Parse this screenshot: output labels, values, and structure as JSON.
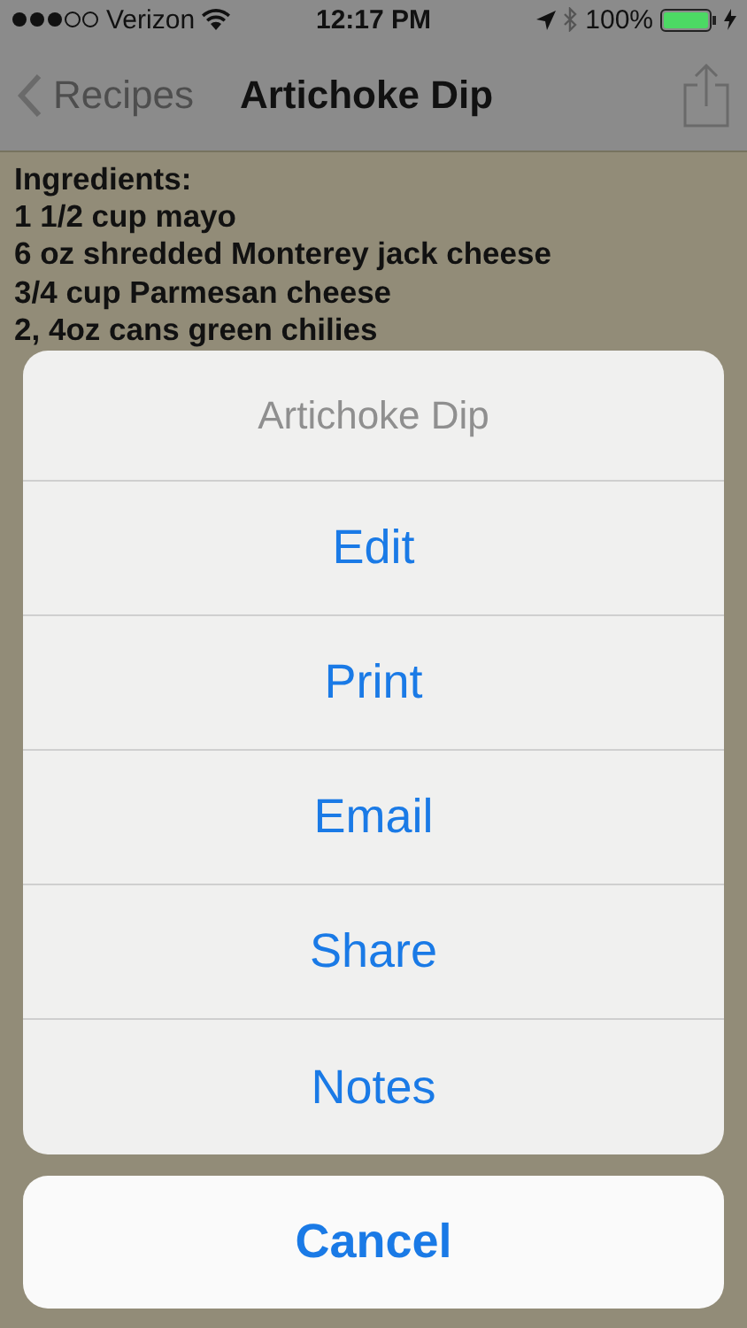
{
  "status_bar": {
    "carrier": "Verizon",
    "time": "12:17 PM",
    "battery": "100%"
  },
  "nav_bar": {
    "back": "Recipes",
    "title": "Artichoke Dip"
  },
  "recipe_lines": [
    "Ingredients:",
    "1 1/2 cup mayo",
    "6 oz shredded Monterey jack cheese",
    "3/4 cup Parmesan cheese",
    "2, 4oz cans green chilies"
  ],
  "action_sheet": {
    "title": "Artichoke Dip",
    "actions": [
      "Edit",
      "Print",
      "Email",
      "Share",
      "Notes"
    ],
    "cancel": "Cancel"
  }
}
